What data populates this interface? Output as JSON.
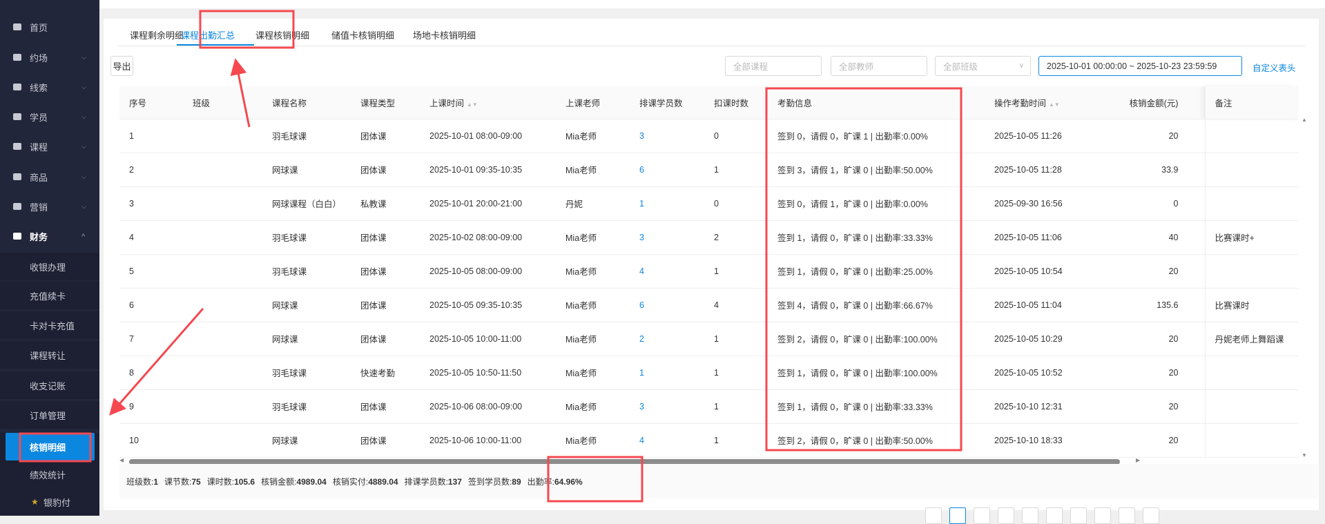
{
  "sidebar": {
    "items": [
      {
        "label": "首页",
        "icon": "home-icon",
        "chevron": ""
      },
      {
        "label": "约场",
        "icon": "calendar-check-icon",
        "chevron": "⌵"
      },
      {
        "label": "线索",
        "icon": "user-list-icon",
        "chevron": "⌵"
      },
      {
        "label": "学员",
        "icon": "id-card-icon",
        "chevron": "⌵"
      },
      {
        "label": "课程",
        "icon": "book-icon",
        "chevron": "⌵"
      },
      {
        "label": "商品",
        "icon": "bag-icon",
        "chevron": "⌵"
      },
      {
        "label": "营销",
        "icon": "discount-icon",
        "chevron": "⌵"
      },
      {
        "label": "财务",
        "icon": "yen-icon",
        "chevron": "^"
      }
    ],
    "sub_items": [
      "收银办理",
      "充值续卡",
      "卡对卡充值",
      "课程转让",
      "收支记账",
      "订单管理",
      "核销明细",
      "绩效统计",
      "银豹付"
    ]
  },
  "tabs": [
    "课程剩余明细",
    "课程出勤汇总",
    "课程核销明细",
    "储值卡核销明细",
    "场地卡核销明细"
  ],
  "toolbar": {
    "export": "导出",
    "course_placeholder": "全部课程",
    "teacher_placeholder": "全部教师",
    "class_placeholder": "全部班级",
    "date_range": "2025-10-01 00:00:00 ~ 2025-10-23 23:59:59",
    "custom_header": "自定义表头"
  },
  "table": {
    "headers": [
      "序号",
      "班级",
      "课程名称",
      "课程类型",
      "上课时间",
      "上课老师",
      "排课学员数",
      "扣课时数",
      "考勤信息",
      "操作考勤时间",
      "核销金额(元)",
      "备注"
    ],
    "rows": [
      [
        "1",
        "",
        "羽毛球课",
        "团体课",
        "2025-10-01 08:00-09:00",
        "Mia老师",
        "3",
        "0",
        "签到 0，请假 0，旷课 1 | 出勤率:0.00%",
        "2025-10-05 11:26",
        "20",
        ""
      ],
      [
        "2",
        "",
        "网球课",
        "团体课",
        "2025-10-01 09:35-10:35",
        "Mia老师",
        "6",
        "1",
        "签到 3，请假 1，旷课 0 | 出勤率:50.00%",
        "2025-10-05 11:28",
        "33.9",
        ""
      ],
      [
        "3",
        "",
        "网球课程（白白）",
        "私教课",
        "2025-10-01 20:00-21:00",
        "丹妮",
        "1",
        "0",
        "签到 0，请假 1，旷课 0 | 出勤率:0.00%",
        "2025-09-30 16:56",
        "0",
        ""
      ],
      [
        "4",
        "",
        "羽毛球课",
        "团体课",
        "2025-10-02 08:00-09:00",
        "Mia老师",
        "3",
        "2",
        "签到 1，请假 0，旷课 0 | 出勤率:33.33%",
        "2025-10-05 11:06",
        "40",
        "比赛课时+"
      ],
      [
        "5",
        "",
        "羽毛球课",
        "团体课",
        "2025-10-05 08:00-09:00",
        "Mia老师",
        "4",
        "1",
        "签到 1，请假 0，旷课 0 | 出勤率:25.00%",
        "2025-10-05 10:54",
        "20",
        ""
      ],
      [
        "6",
        "",
        "网球课",
        "团体课",
        "2025-10-05 09:35-10:35",
        "Mia老师",
        "6",
        "4",
        "签到 4，请假 0，旷课 0 | 出勤率:66.67%",
        "2025-10-05 11:04",
        "135.6",
        "比赛课时"
      ],
      [
        "7",
        "",
        "网球课",
        "团体课",
        "2025-10-05 10:00-11:00",
        "Mia老师",
        "2",
        "1",
        "签到 2，请假 0，旷课 0 | 出勤率:100.00%",
        "2025-10-05 10:29",
        "20",
        "丹妮老师上舞蹈课"
      ],
      [
        "8",
        "",
        "羽毛球课",
        "快速考勤",
        "2025-10-05 10:50-11:50",
        "Mia老师",
        "1",
        "1",
        "签到 1，请假 0，旷课 0 | 出勤率:100.00%",
        "2025-10-05 10:52",
        "20",
        ""
      ],
      [
        "9",
        "",
        "羽毛球课",
        "团体课",
        "2025-10-06 08:00-09:00",
        "Mia老师",
        "3",
        "1",
        "签到 1，请假 0，旷课 0 | 出勤率:33.33%",
        "2025-10-10 12:31",
        "20",
        ""
      ],
      [
        "10",
        "",
        "网球课",
        "团体课",
        "2025-10-06 10:00-11:00",
        "Mia老师",
        "4",
        "1",
        "签到 2，请假 0，旷课 0 | 出勤率:50.00%",
        "2025-10-10 18:33",
        "20",
        ""
      ]
    ]
  },
  "summary": [
    {
      "label": "班级数:",
      "value": "1"
    },
    {
      "label": "课节数:",
      "value": "75"
    },
    {
      "label": "课时数:",
      "value": "105.6"
    },
    {
      "label": "核销金额:",
      "value": "4989.04"
    },
    {
      "label": "核销实付:",
      "value": "4889.04"
    },
    {
      "label": "排课学员数:",
      "value": "137"
    },
    {
      "label": "签到学员数:",
      "value": "89"
    },
    {
      "label": "出勤率:",
      "value": "64.96%"
    }
  ],
  "colors": {
    "accent": "#0b87e0",
    "sidebar": "#22263a",
    "annotation": "#f5484f"
  }
}
